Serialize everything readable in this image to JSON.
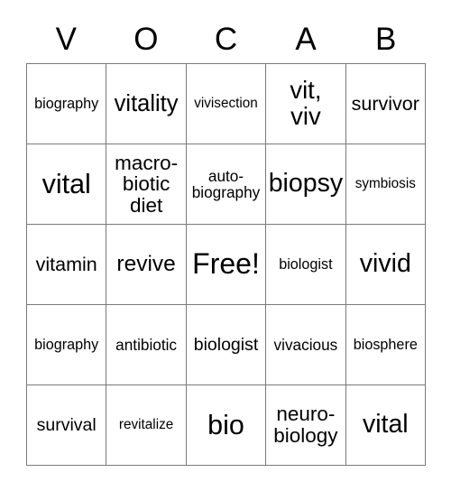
{
  "card": {
    "title_letters": [
      "V",
      "O",
      "C",
      "A",
      "B"
    ],
    "free_space_label": "Free!",
    "grid": [
      [
        {
          "text": "biography",
          "size": "fs-16"
        },
        {
          "text": "vitality",
          "size": "fs-25"
        },
        {
          "text": "vivisection",
          "size": "fs-15"
        },
        {
          "text": "vit,\nviv",
          "size": "fs-27"
        },
        {
          "text": "survivor",
          "size": "fs-21"
        }
      ],
      [
        {
          "text": "vital",
          "size": "fs-30"
        },
        {
          "text": "macro-\nbiotic\ndiet",
          "size": "fs-22"
        },
        {
          "text": "auto-\nbiography",
          "size": "fs-17"
        },
        {
          "text": "biopsy",
          "size": "fs-28"
        },
        {
          "text": "symbiosis",
          "size": "fs-15"
        }
      ],
      [
        {
          "text": "vitamin",
          "size": "fs-21"
        },
        {
          "text": "revive",
          "size": "fs-24"
        },
        {
          "text": "Free!",
          "size": "fs-32"
        },
        {
          "text": "biologist",
          "size": "fs-16"
        },
        {
          "text": "vivid",
          "size": "fs-28"
        }
      ],
      [
        {
          "text": "biography",
          "size": "fs-16"
        },
        {
          "text": "antibiotic",
          "size": "fs-17"
        },
        {
          "text": "biologist",
          "size": "fs-19"
        },
        {
          "text": "vivacious",
          "size": "fs-17"
        },
        {
          "text": "biosphere",
          "size": "fs-16"
        }
      ],
      [
        {
          "text": "survival",
          "size": "fs-19"
        },
        {
          "text": "revitalize",
          "size": "fs-15"
        },
        {
          "text": "bio",
          "size": "fs-30"
        },
        {
          "text": "neuro-\nbiology",
          "size": "fs-22"
        },
        {
          "text": "vital",
          "size": "fs-28"
        }
      ]
    ]
  },
  "colors": {
    "grid_line": "#7a7a7a",
    "text": "#000000",
    "background": "#ffffff"
  }
}
